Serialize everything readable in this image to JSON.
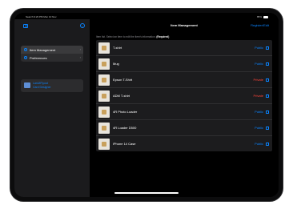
{
  "status_bar": {
    "left": "Search 9:23 PM Mon 10 Nov",
    "battery": "85%"
  },
  "sidebar": {
    "items": [
      {
        "label": "Item Management",
        "icon": "box-icon"
      },
      {
        "label": "Preferences",
        "icon": "gear-icon"
      }
    ],
    "account": {
      "line1": "LanUIFlyout",
      "line2": "Card Designer"
    }
  },
  "main": {
    "title": "Item Management",
    "action": "Register/Edit",
    "instruction": "Item list. Select an item to edit the item's information.",
    "instruction_required": "(Required)",
    "items": [
      {
        "name": "T-shirt",
        "visibility": "Public"
      },
      {
        "name": "Mug",
        "visibility": "Public"
      },
      {
        "name": "Epson T-Shirt",
        "visibility": "Private"
      },
      {
        "name": "ADM T-shirt",
        "visibility": "Private"
      },
      {
        "name": "4R Photo Loader",
        "visibility": "Public"
      },
      {
        "name": "4R Loader D500",
        "visibility": "Public"
      },
      {
        "name": "iPhone 14 Case",
        "visibility": "Public"
      }
    ]
  },
  "colors": {
    "accent": "#0a84ff",
    "public": "#0a84ff",
    "private": "#ff453a"
  }
}
